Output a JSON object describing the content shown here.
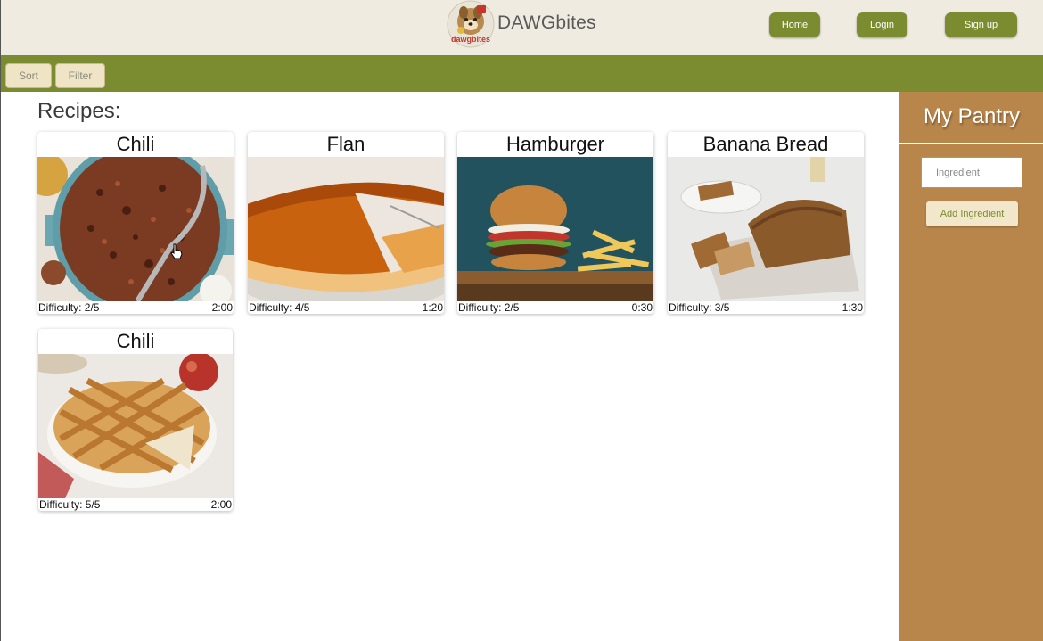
{
  "header": {
    "brand": "DAWGbites",
    "logo_text": "dawgbites",
    "nav": {
      "home": "Home",
      "login": "Login",
      "signup": "Sign up"
    }
  },
  "toolbar": {
    "sort": "Sort",
    "filter": "Filter"
  },
  "main": {
    "title": "Recipes:",
    "recipes": [
      {
        "name": "Chili",
        "difficulty": "Difficulty: 2/5",
        "time": "2:00",
        "image": "chili-pot-image"
      },
      {
        "name": "Flan",
        "difficulty": "Difficulty: 4/5",
        "time": "1:20",
        "image": "flan-image"
      },
      {
        "name": "Hamburger",
        "difficulty": "Difficulty: 2/5",
        "time": "0:30",
        "image": "hamburger-fries-image"
      },
      {
        "name": "Banana Bread",
        "difficulty": "Difficulty: 3/5",
        "time": "1:30",
        "image": "banana-bread-image"
      },
      {
        "name": "Chili",
        "difficulty": "Difficulty: 5/5",
        "time": "2:00",
        "image": "apple-pie-image"
      }
    ]
  },
  "pantry": {
    "title": "My Pantry",
    "input_placeholder": "Ingredient",
    "add_label": "Add Ingredient"
  },
  "colors": {
    "header_bg": "#f0ebe1",
    "accent_green": "#7b8c30",
    "pantry_bg": "#b8864a",
    "button_cream": "#f3e7cb"
  }
}
